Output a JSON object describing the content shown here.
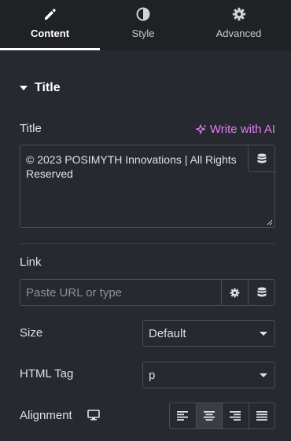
{
  "tabs": [
    {
      "label": "Content",
      "icon": "pencil-icon",
      "active": true
    },
    {
      "label": "Style",
      "icon": "contrast-icon",
      "active": false
    },
    {
      "label": "Advanced",
      "icon": "gear-icon",
      "active": false
    }
  ],
  "section": {
    "title": "Title"
  },
  "title_field": {
    "label": "Title",
    "ai_label": "Write with AI",
    "value": "© 2023 POSIMYTH Innovations | All Rights Reserved"
  },
  "link_field": {
    "label": "Link",
    "placeholder": "Paste URL or type"
  },
  "size_field": {
    "label": "Size",
    "value": "Default"
  },
  "html_tag_field": {
    "label": "HTML Tag",
    "value": "p"
  },
  "alignment_field": {
    "label": "Alignment",
    "options": [
      "left",
      "center",
      "right",
      "justify"
    ],
    "selected": "center"
  },
  "colors": {
    "accent_ai": "#e37ef2",
    "panel": "#26292f",
    "tabs_bg": "#1f2124"
  }
}
